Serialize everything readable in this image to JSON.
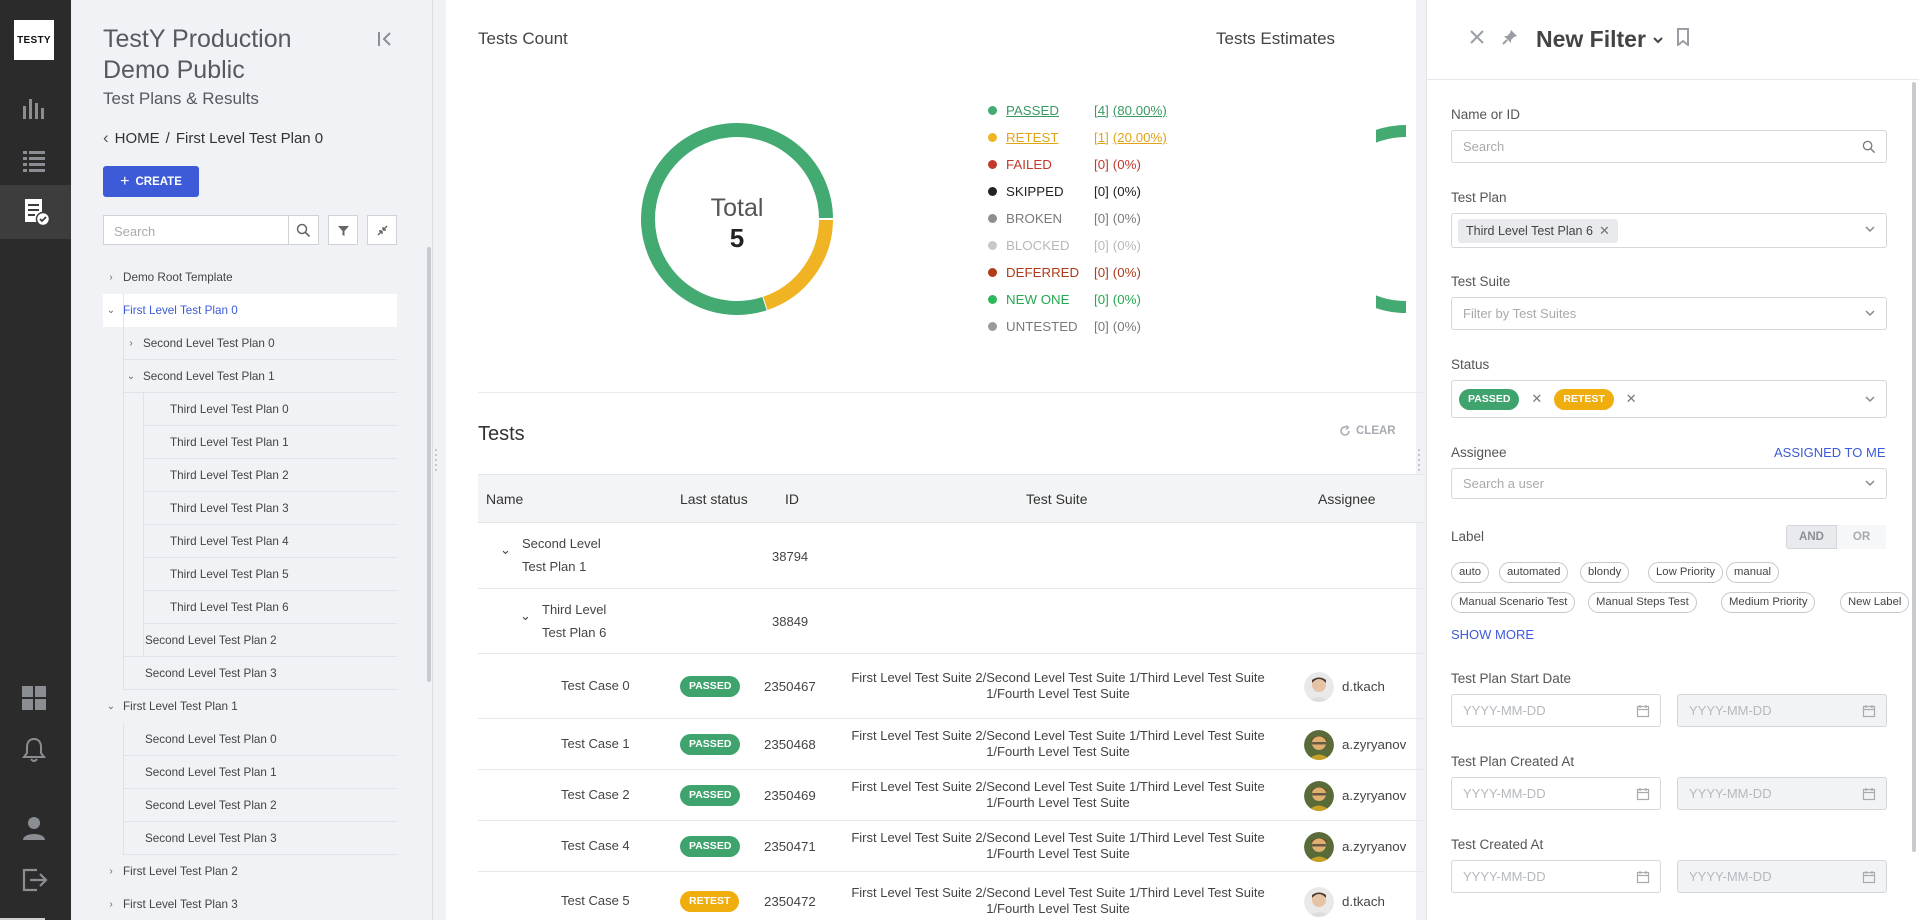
{
  "app": {
    "logo": "TESTY"
  },
  "project": {
    "title": "TestY Production Demo Public",
    "subtitle": "Test Plans & Results"
  },
  "breadcrumb": {
    "home": "HOME",
    "separator": "/",
    "current": "First Level Test Plan 0"
  },
  "create_button": "CREATE",
  "tree_search_placeholder": "Search",
  "tree": [
    {
      "label": "Demo Root Template",
      "level": 0,
      "arrow": "›"
    },
    {
      "label": "First Level Test Plan 0",
      "level": 0,
      "arrow": "⌄",
      "selected": true
    },
    {
      "label": "Second Level Test Plan 0",
      "level": 1,
      "arrow": "›"
    },
    {
      "label": "Second Level Test Plan 1",
      "level": 1,
      "arrow": "⌄"
    },
    {
      "label": "Third Level Test Plan 0",
      "level": 2
    },
    {
      "label": "Third Level Test Plan 1",
      "level": 2
    },
    {
      "label": "Third Level Test Plan 2",
      "level": 2
    },
    {
      "label": "Third Level Test Plan 3",
      "level": 2
    },
    {
      "label": "Third Level Test Plan 4",
      "level": 2
    },
    {
      "label": "Third Level Test Plan 5",
      "level": 2
    },
    {
      "label": "Third Level Test Plan 6",
      "level": 2
    },
    {
      "label": "Second Level Test Plan 2",
      "level": 1
    },
    {
      "label": "Second Level Test Plan 3",
      "level": 1
    },
    {
      "label": "First Level Test Plan 1",
      "level": 0,
      "arrow": "⌄"
    },
    {
      "label": "Second Level Test Plan 0",
      "level": 1
    },
    {
      "label": "Second Level Test Plan 1",
      "level": 1
    },
    {
      "label": "Second Level Test Plan 2",
      "level": 1
    },
    {
      "label": "Second Level Test Plan 3",
      "level": 1
    },
    {
      "label": "First Level Test Plan 2",
      "level": 0,
      "arrow": "›"
    },
    {
      "label": "First Level Test Plan 3",
      "level": 0,
      "arrow": "›"
    }
  ],
  "stats": {
    "tests_count_title": "Tests Count",
    "tests_estimates_title": "Tests Estimates",
    "total_label": "Total",
    "total_value": "5"
  },
  "chart_data": {
    "type": "pie",
    "title": "Tests Count",
    "categories": [
      "PASSED",
      "RETEST",
      "FAILED",
      "SKIPPED",
      "BROKEN",
      "BLOCKED",
      "DEFERRED",
      "NEW ONE",
      "UNTESTED"
    ],
    "values": [
      4,
      1,
      0,
      0,
      0,
      0,
      0,
      0,
      0
    ],
    "percents": [
      "80.00%",
      "20.00%",
      "0%",
      "0%",
      "0%",
      "0%",
      "0%",
      "0%",
      "0%"
    ],
    "colors": [
      "#43aa72",
      "#f0b323",
      "#c0392b",
      "#222222",
      "#8e8e8e",
      "#c8c8c8",
      "#b03a1a",
      "#2eb85c",
      "#9a9a9a"
    ]
  },
  "legend": [
    {
      "name": "PASSED",
      "count": "[4]",
      "pct": "(80.00%)",
      "color": "#43aa72",
      "text_color": "#3a9a64",
      "underline": true
    },
    {
      "name": "RETEST",
      "count": "[1]",
      "pct": "(20.00%)",
      "color": "#f0b323",
      "text_color": "#e0a418",
      "underline": true
    },
    {
      "name": "FAILED",
      "count": "[0]",
      "pct": "(0%)",
      "color": "#c0392b",
      "text_color": "#c0392b"
    },
    {
      "name": "SKIPPED",
      "count": "[0]",
      "pct": "(0%)",
      "color": "#222222",
      "text_color": "#222222"
    },
    {
      "name": "BROKEN",
      "count": "[0]",
      "pct": "(0%)",
      "color": "#8e8e8e",
      "text_color": "#7a7a7a"
    },
    {
      "name": "BLOCKED",
      "count": "[0]",
      "pct": "(0%)",
      "color": "#c8c8c8",
      "text_color": "#b8b8b8"
    },
    {
      "name": "DEFERRED",
      "count": "[0]",
      "pct": "(0%)",
      "color": "#b03a1a",
      "text_color": "#b03a1a"
    },
    {
      "name": "NEW ONE",
      "count": "[0]",
      "pct": "(0%)",
      "color": "#2eb85c",
      "text_color": "#24a850"
    },
    {
      "name": "UNTESTED",
      "count": "[0]",
      "pct": "(0%)",
      "color": "#9a9a9a",
      "text_color": "#7a7a7a"
    }
  ],
  "tests": {
    "title": "Tests",
    "clear": "CLEAR",
    "columns": [
      "Name",
      "Last status",
      "ID",
      "Test Suite",
      "Assignee"
    ],
    "groups": [
      {
        "name_line1": "Second Level",
        "name_line2": "Test Plan 1",
        "id": "38794"
      },
      {
        "name_line1": "Third Level",
        "name_line2": "Test Plan 6",
        "id": "38849"
      }
    ],
    "rows": [
      {
        "name": "Test Case 0",
        "status": "PASSED",
        "id": "2350467",
        "suite1": "First Level Test Suite 2/Second Level Test Suite 1/Third Level Test Suite",
        "suite2": "1/Fourth Level Test Suite",
        "assignee": "d.tkach",
        "avatar": "a"
      },
      {
        "name": "Test Case 1",
        "status": "PASSED",
        "id": "2350468",
        "suite1": "First Level Test Suite 2/Second Level Test Suite 1/Third Level Test Suite",
        "suite2": "1/Fourth Level Test Suite",
        "assignee": "a.zyryanov",
        "avatar": "b"
      },
      {
        "name": "Test Case 2",
        "status": "PASSED",
        "id": "2350469",
        "suite1": "First Level Test Suite 2/Second Level Test Suite 1/Third Level Test Suite",
        "suite2": "1/Fourth Level Test Suite",
        "assignee": "a.zyryanov",
        "avatar": "b"
      },
      {
        "name": "Test Case 4",
        "status": "PASSED",
        "id": "2350471",
        "suite1": "First Level Test Suite 2/Second Level Test Suite 1/Third Level Test Suite",
        "suite2": "1/Fourth Level Test Suite",
        "assignee": "a.zyryanov",
        "avatar": "b"
      },
      {
        "name": "Test Case 5",
        "status": "RETEST",
        "id": "2350472",
        "suite1": "First Level Test Suite 2/Second Level Test Suite 1/Third Level Test Suite",
        "suite2": "1/Fourth Level Test Suite",
        "assignee": "d.tkach",
        "avatar": "a"
      }
    ]
  },
  "filter": {
    "title": "New Filter",
    "name_label": "Name or ID",
    "name_placeholder": "Search",
    "plan_label": "Test Plan",
    "plan_chip": "Third Level Test Plan 6",
    "suite_label": "Test Suite",
    "suite_placeholder": "Filter by Test Suites",
    "status_label": "Status",
    "status_chips": [
      "PASSED",
      "RETEST"
    ],
    "assignee_label": "Assignee",
    "assigned_to_me": "ASSIGNED TO ME",
    "assignee_placeholder": "Search a user",
    "label_label": "Label",
    "and": "AND",
    "or": "OR",
    "labels": [
      "auto",
      "automated",
      "blondy",
      "Low Priority",
      "manual",
      "Manual Scenario Test",
      "Manual Steps Test",
      "Medium Priority",
      "New Label"
    ],
    "show_more": "SHOW MORE",
    "start_date_label": "Test Plan Start Date",
    "created_label": "Test Plan Created At",
    "test_created_label": "Test Created At",
    "date_placeholder": "YYYY-MM-DD"
  }
}
